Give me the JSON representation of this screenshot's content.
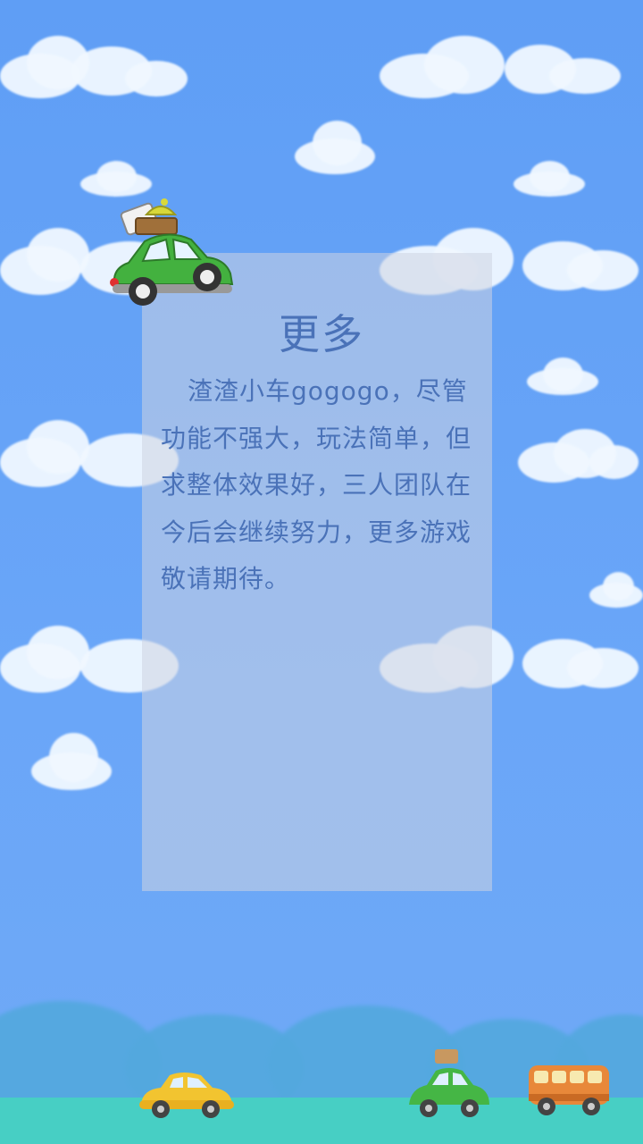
{
  "panel": {
    "title": "更多",
    "text": "渣渣小车gogogo，尽管功能不强大，玩法简单，但求整体效果好，三人团队在今后会继续努力，更多游戏敬请期待。"
  },
  "icons": {
    "hero_car": "green-car-with-luggage-icon",
    "yellow_car": "yellow-car-icon",
    "green_car": "green-car-icon",
    "bus": "orange-bus-icon"
  },
  "colors": {
    "sky": "#62a0f6",
    "panel_text": "#4a72b8",
    "ground": "#47cfc4"
  }
}
